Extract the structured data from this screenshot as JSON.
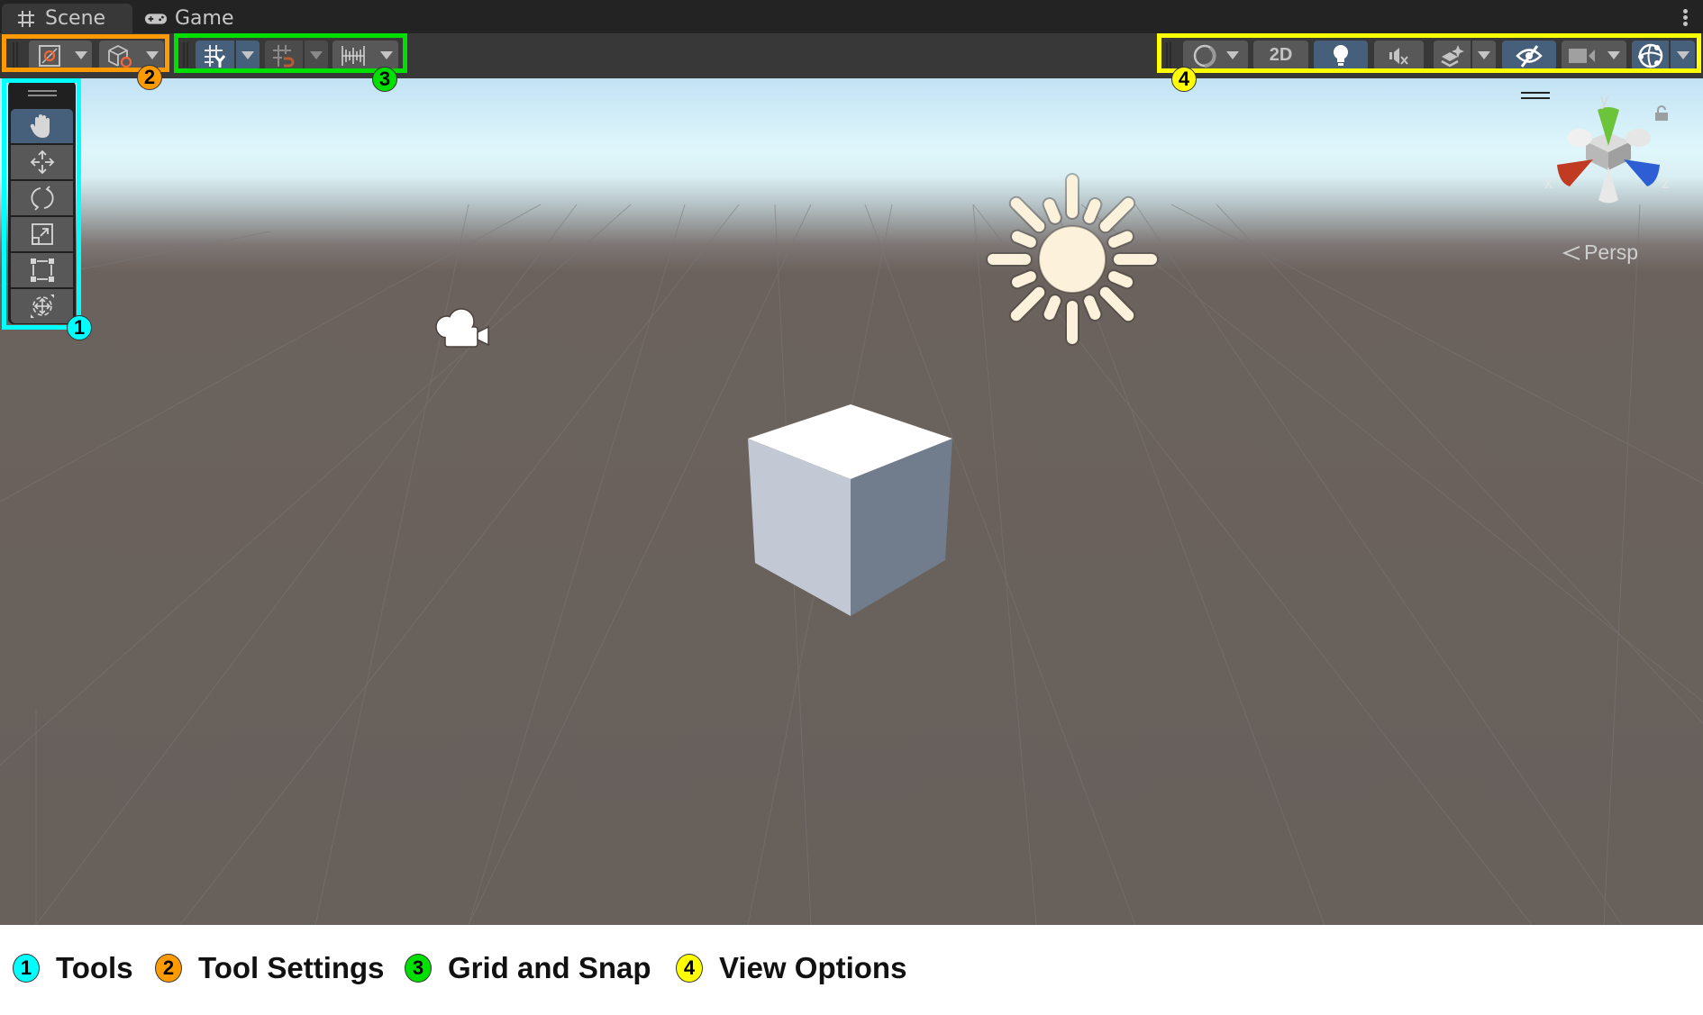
{
  "tabs": [
    {
      "label": "Scene",
      "icon": "grid-hash-icon",
      "active": true
    },
    {
      "label": "Game",
      "icon": "gamepad-icon",
      "active": false
    }
  ],
  "window_menu_icon": "kebab-menu-icon",
  "toolbar": {
    "tool_settings": [
      {
        "name": "pivot-center-toggle",
        "icon": "pivot-icon",
        "dropdown": true
      },
      {
        "name": "pivot-rotation-toggle",
        "icon": "cube-local-icon",
        "dropdown": true
      }
    ],
    "grid_and_snap": [
      {
        "name": "grid-visibility-toggle",
        "icon": "grid-y-icon",
        "active": true,
        "dropdown": true
      },
      {
        "name": "grid-snap-toggle",
        "icon": "grid-magnet-icon",
        "active": false,
        "dropdown": true
      },
      {
        "name": "increment-snap",
        "icon": "ruler-icon",
        "dropdown": true
      }
    ],
    "view_options": {
      "draw_mode_icon": "shaded-sphere-icon",
      "mode_2d_label": "2D",
      "lighting_icon": "lightbulb-icon",
      "audio_icon": "audio-mute-icon",
      "effects_icon": "effects-layers-icon",
      "visibility_icon": "eye-hidden-icon",
      "camera_icon": "scene-camera-icon",
      "gizmos_icon": "gizmos-sphere-icon"
    }
  },
  "tools": [
    {
      "label": "View Tool",
      "icon": "hand-icon",
      "active": true
    },
    {
      "label": "Move Tool",
      "icon": "move-arrows-icon",
      "active": false
    },
    {
      "label": "Rotate Tool",
      "icon": "rotate-icon",
      "active": false
    },
    {
      "label": "Scale Tool",
      "icon": "scale-icon",
      "active": false
    },
    {
      "label": "Rect Tool",
      "icon": "rect-icon",
      "active": false
    },
    {
      "label": "Transform Tool",
      "icon": "transform-icon",
      "active": false
    }
  ],
  "scene": {
    "orientation_gizmo": {
      "x_label": "x",
      "y_label": "y",
      "z_label": "z",
      "projection_label": "Persp"
    },
    "objects": [
      "Directional Light",
      "Main Camera",
      "Cube"
    ]
  },
  "annotations": [
    {
      "number": "1",
      "label": "Tools",
      "color": "#00ffff"
    },
    {
      "number": "2",
      "label": "Tool Settings",
      "color": "#ff9a00"
    },
    {
      "number": "3",
      "label": "Grid and Snap",
      "color": "#00e000"
    },
    {
      "number": "4",
      "label": "View Options",
      "color": "#ffff00"
    }
  ]
}
